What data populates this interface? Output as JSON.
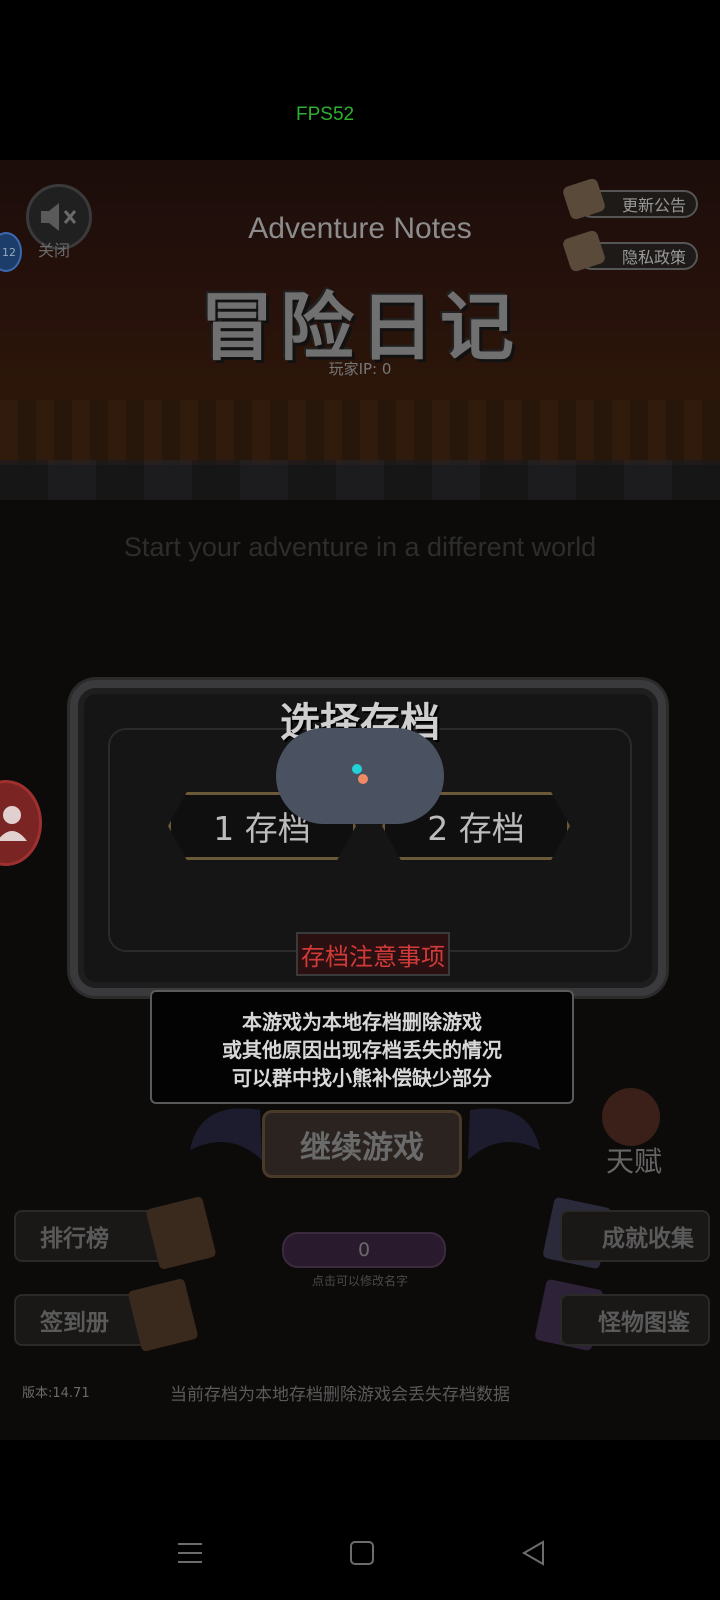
{
  "status": {
    "fps": "FPS52"
  },
  "header": {
    "sound_label": "关闭",
    "side_badge": "12",
    "title_en": "Adventure Notes",
    "title_cn": "冒险日记",
    "player_ip": "玩家IP:  0",
    "update_notice": "更新公告",
    "privacy_policy": "隐私政策"
  },
  "subtitle": "Start your adventure in a different world",
  "save_dialog": {
    "title": "选择存档",
    "slots": [
      "1 存档",
      "2 存档"
    ],
    "notice_title": "存档注意事项",
    "notice_lines": [
      "本游戏为本地存档删除游戏",
      "或其他原因出现存档丢失的情况",
      "可以群中找小熊补偿缺少部分"
    ]
  },
  "menu": {
    "continue": "继续游戏",
    "talent": "天赋",
    "leaderboard": "排行榜",
    "signin": "签到册",
    "achievements": "成就收集",
    "monsters": "怪物图鉴",
    "name_value": "0",
    "name_hint": "点击可以修改名字"
  },
  "footer": {
    "version": "版本:14.71",
    "note": "当前存档为本地存档删除游戏会丢失存档数据"
  },
  "icons": {
    "sound": "speaker-muted-icon",
    "avatar": "user-icon",
    "nav": [
      "menu-icon",
      "home-icon",
      "back-icon"
    ]
  },
  "colors": {
    "fps": "#2fb02f",
    "notice_title": "#d23a3a",
    "loading_dot_a": "#22d1d6",
    "loading_dot_b": "#f08a65"
  }
}
